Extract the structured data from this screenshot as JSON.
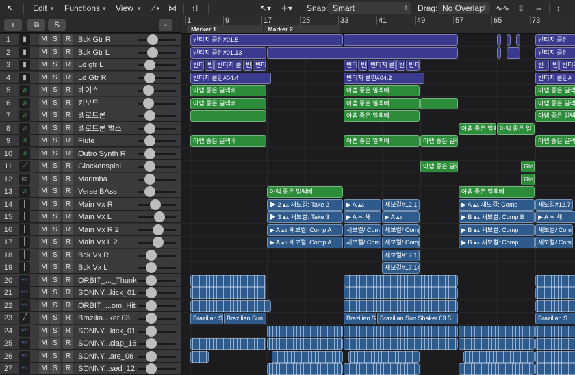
{
  "toolbar": {
    "edit": "Edit",
    "functions": "Functions",
    "view": "View",
    "snap_label": "Snap:",
    "snap_value": "Smart",
    "drag_label": "Drag:",
    "drag_value": "No Overlap"
  },
  "track_header": {
    "add": "+",
    "dup": "⧉",
    "s": "S"
  },
  "ruler": {
    "bars": [
      "1",
      "9",
      "17",
      "25",
      "33",
      "41",
      "49",
      "57",
      "65",
      "73"
    ],
    "markers": [
      "Marker 1",
      "Marker 2"
    ]
  },
  "msr": {
    "m": "M",
    "s": "S",
    "r": "R"
  },
  "tracks": [
    {
      "num": "1",
      "name": "Bck Gtr R",
      "icon": "amp"
    },
    {
      "num": "2",
      "name": "Bck Gtr L",
      "icon": "amp"
    },
    {
      "num": "3",
      "name": "Ld gtr L",
      "icon": "amp"
    },
    {
      "num": "4",
      "name": "Ld Gtr R",
      "icon": "amp"
    },
    {
      "num": "5",
      "name": "베이스",
      "icon": "note"
    },
    {
      "num": "6",
      "name": "키보드",
      "icon": "note"
    },
    {
      "num": "7",
      "name": "멜로트론",
      "icon": "note"
    },
    {
      "num": "8",
      "name": "멜로트론 벌스",
      "icon": "note"
    },
    {
      "num": "9",
      "name": "Flute",
      "icon": "note"
    },
    {
      "num": "10",
      "name": "Outro Synth R",
      "icon": "note"
    },
    {
      "num": "11",
      "name": "Glockenspiel",
      "icon": "mallet"
    },
    {
      "num": "12",
      "name": "Marimba",
      "icon": "marimba"
    },
    {
      "num": "13",
      "name": "Verse BAss",
      "icon": "note"
    },
    {
      "num": "14",
      "name": "Main Vx R",
      "icon": "mic"
    },
    {
      "num": "15",
      "name": "Main Vx L",
      "icon": "mic"
    },
    {
      "num": "16",
      "name": "Main Vx R 2",
      "icon": "mic"
    },
    {
      "num": "17",
      "name": "Main Vx L 2",
      "icon": "mic"
    },
    {
      "num": "18",
      "name": "Bck Vx R",
      "icon": "mic"
    },
    {
      "num": "19",
      "name": "Bck Vx L",
      "icon": "mic"
    },
    {
      "num": "20",
      "name": "ORBIT_..._Thunk",
      "icon": "wave"
    },
    {
      "num": "21",
      "name": "SONNY...kick_01",
      "icon": "wave"
    },
    {
      "num": "22",
      "name": "ORBIT_...om_Hit",
      "icon": "wave"
    },
    {
      "num": "23",
      "name": "Brazilia...ker 03",
      "icon": "stick"
    },
    {
      "num": "24",
      "name": "SONNY...kick_01",
      "icon": "wave"
    },
    {
      "num": "25",
      "name": "SONNY...clap_16",
      "icon": "wave"
    },
    {
      "num": "26",
      "name": "SONNY...are_06",
      "icon": "wave"
    },
    {
      "num": "27",
      "name": "SONNY...sed_12",
      "icon": "wave"
    }
  ],
  "volume_levels": [
    0.35,
    0.35,
    0.25,
    0.25,
    0.2,
    0.2,
    0.25,
    0.25,
    0.25,
    0.25,
    0.25,
    0.25,
    0.25,
    0.45,
    0.6,
    0.55,
    0.55,
    0.3,
    0.3,
    0.3,
    0.3,
    0.3,
    0.3,
    0.3,
    0.3,
    0.3,
    0.3
  ],
  "regions": [
    {
      "t": 1,
      "b": 1,
      "e": 33,
      "l": "빈티지 클린#01.5",
      "c": "blue"
    },
    {
      "t": 1,
      "b": 33,
      "e": 57,
      "l": "",
      "c": "blue"
    },
    {
      "t": 1,
      "b": 65,
      "e": 66,
      "l": "",
      "c": "blue"
    },
    {
      "t": 1,
      "b": 67,
      "e": 68,
      "l": "",
      "c": "blue"
    },
    {
      "t": 1,
      "b": 69,
      "e": 70,
      "l": "",
      "c": "blue"
    },
    {
      "t": 1,
      "b": 73,
      "e": 84,
      "l": "빈티지 클린",
      "c": "blue"
    },
    {
      "t": 2,
      "b": 1,
      "e": 17,
      "l": "빈티지 클린#01.13",
      "c": "blue"
    },
    {
      "t": 2,
      "b": 17,
      "e": 57,
      "l": "",
      "c": "blue"
    },
    {
      "t": 2,
      "b": 65,
      "e": 66,
      "l": "",
      "c": "blue"
    },
    {
      "t": 2,
      "b": 67,
      "e": 70,
      "l": "",
      "c": "blue"
    },
    {
      "t": 2,
      "b": 73,
      "e": 84,
      "l": "빈티지 클린",
      "c": "blue"
    },
    {
      "t": 3,
      "b": 1,
      "e": 4,
      "l": "빈티",
      "c": "blue"
    },
    {
      "t": 3,
      "b": 4,
      "e": 6,
      "l": "빈",
      "c": "blue"
    },
    {
      "t": 3,
      "b": 6,
      "e": 12,
      "l": "빈티지 클",
      "c": "blue"
    },
    {
      "t": 3,
      "b": 12,
      "e": 14,
      "l": "빈",
      "c": "blue"
    },
    {
      "t": 3,
      "b": 14,
      "e": 17,
      "l": "빈티",
      "c": "blue"
    },
    {
      "t": 3,
      "b": 33,
      "e": 36,
      "l": "빈티",
      "c": "blue"
    },
    {
      "t": 3,
      "b": 36,
      "e": 38,
      "l": "빈",
      "c": "blue"
    },
    {
      "t": 3,
      "b": 38,
      "e": 44,
      "l": "빈티지 클린",
      "c": "blue"
    },
    {
      "t": 3,
      "b": 44,
      "e": 46,
      "l": "빈",
      "c": "blue"
    },
    {
      "t": 3,
      "b": 46,
      "e": 49,
      "l": "빈티",
      "c": "blue"
    },
    {
      "t": 3,
      "b": 73,
      "e": 76,
      "l": "빈",
      "c": "blue"
    },
    {
      "t": 3,
      "b": 76,
      "e": 78,
      "l": "빈",
      "c": "blue"
    },
    {
      "t": 3,
      "b": 78,
      "e": 84,
      "l": "빈티지",
      "c": "blue"
    },
    {
      "t": 4,
      "b": 1,
      "e": 18,
      "l": "빈티지 클린#04.4",
      "c": "blue"
    },
    {
      "t": 4,
      "b": 33,
      "e": 50,
      "l": "빈티지 클린#04.2",
      "c": "blue"
    },
    {
      "t": 4,
      "b": 73,
      "e": 84,
      "l": "빈티지 클린#",
      "c": "blue"
    },
    {
      "t": 5,
      "b": 1,
      "e": 17,
      "l": "아랩 좋은 일렉베",
      "c": "green"
    },
    {
      "t": 5,
      "b": 33,
      "e": 49,
      "l": "아랩 좋은 일렉베",
      "c": "green"
    },
    {
      "t": 5,
      "b": 73,
      "e": 84,
      "l": "아랩 좋은 일렉",
      "c": "green"
    },
    {
      "t": 6,
      "b": 1,
      "e": 17,
      "l": "아랩 좋은 일렉베",
      "c": "green"
    },
    {
      "t": 6,
      "b": 33,
      "e": 49,
      "l": "아랩 좋은 일렉베",
      "c": "green"
    },
    {
      "t": 6,
      "b": 49,
      "e": 57,
      "l": "",
      "c": "green"
    },
    {
      "t": 6,
      "b": 73,
      "e": 84,
      "l": "아랩 좋은 일렉",
      "c": "green"
    },
    {
      "t": 7,
      "b": 1,
      "e": 17,
      "l": "",
      "c": "green"
    },
    {
      "t": 7,
      "b": 33,
      "e": 49,
      "l": "아랩 좋은 일렉베",
      "c": "green"
    },
    {
      "t": 7,
      "b": 73,
      "e": 84,
      "l": "아랩 좋은 일렉",
      "c": "green"
    },
    {
      "t": 8,
      "b": 57,
      "e": 65,
      "l": "아랩 좋은 일렉",
      "c": "green"
    },
    {
      "t": 8,
      "b": 65,
      "e": 73,
      "l": "아랩 좋은 일",
      "c": "green"
    },
    {
      "t": 9,
      "b": 1,
      "e": 17,
      "l": "아랩 좋은 일렉베",
      "c": "green"
    },
    {
      "t": 9,
      "b": 33,
      "e": 49,
      "l": "아랩 좋은 일렉베",
      "c": "green"
    },
    {
      "t": 9,
      "b": 49,
      "e": 57,
      "l": "아랩 좋은 일렉",
      "c": "green"
    },
    {
      "t": 9,
      "b": 73,
      "e": 84,
      "l": "아랩 좋은 일렉",
      "c": "green"
    },
    {
      "t": 11,
      "b": 49,
      "e": 57,
      "l": "아랩 좋은 일렉",
      "c": "green"
    },
    {
      "t": 11,
      "b": 70,
      "e": 73,
      "l": "Glo",
      "c": "green"
    },
    {
      "t": 12,
      "b": 70,
      "e": 73,
      "l": "Glo",
      "c": "green"
    },
    {
      "t": 13,
      "b": 17,
      "e": 33,
      "l": "아랩 좋은 일렉베",
      "c": "green"
    },
    {
      "t": 13,
      "b": 57,
      "e": 73,
      "l": "아랩 좋은 일렉베",
      "c": "green"
    },
    {
      "t": 14,
      "b": 17,
      "e": 33,
      "l": "▶ 2 ▴▵ 새보컬: Take 2",
      "c": "audio"
    },
    {
      "t": 14,
      "b": 33,
      "e": 41,
      "l": "▶ A ▴▵",
      "c": "audio"
    },
    {
      "t": 14,
      "b": 41,
      "e": 49,
      "l": "새보컬#12.1",
      "c": "audio"
    },
    {
      "t": 14,
      "b": 57,
      "e": 73,
      "l": "▶ A ▴▵ 새보컬: Comp",
      "c": "audio"
    },
    {
      "t": 14,
      "b": 73,
      "e": 81,
      "l": "새보컬#12.7",
      "c": "audio"
    },
    {
      "t": 15,
      "b": 17,
      "e": 33,
      "l": "▶ 3 ▴▵ 새보컬: Take 3",
      "c": "audio"
    },
    {
      "t": 15,
      "b": 33,
      "e": 41,
      "l": "▶ A ✂ 새",
      "c": "audio"
    },
    {
      "t": 15,
      "b": 41,
      "e": 49,
      "l": "▶ A ▴▵",
      "c": "audio"
    },
    {
      "t": 15,
      "b": 57,
      "e": 73,
      "l": "▶ B ▴▵ 새보컬: Comp B",
      "c": "audio"
    },
    {
      "t": 15,
      "b": 73,
      "e": 84,
      "l": "▶ A ✂ 새",
      "c": "audio"
    },
    {
      "t": 16,
      "b": 17,
      "e": 33,
      "l": "▶ A ▴▵ 새보컬: Comp A",
      "c": "audio"
    },
    {
      "t": 16,
      "b": 33,
      "e": 41,
      "l": "새보컬/ Com",
      "c": "audio"
    },
    {
      "t": 16,
      "b": 41,
      "e": 49,
      "l": "새보컬/ Comp",
      "c": "audio"
    },
    {
      "t": 16,
      "b": 57,
      "e": 73,
      "l": "▶ B ▴▵ 새보컬: Comp",
      "c": "audio"
    },
    {
      "t": 16,
      "b": 73,
      "e": 81,
      "l": "새보컬/ Com",
      "c": "audio"
    },
    {
      "t": 17,
      "b": 17,
      "e": 33,
      "l": "▶ A ▴▵ 새보컬: Comp A",
      "c": "audio"
    },
    {
      "t": 17,
      "b": 33,
      "e": 41,
      "l": "새보컬/ Com",
      "c": "audio"
    },
    {
      "t": 17,
      "b": 41,
      "e": 49,
      "l": "새보컬/ Comp",
      "c": "audio"
    },
    {
      "t": 17,
      "b": 57,
      "e": 73,
      "l": "▶ B ▴▵ 새보컬: Comp",
      "c": "audio"
    },
    {
      "t": 17,
      "b": 73,
      "e": 81,
      "l": "새보컬/ Com",
      "c": "audio"
    },
    {
      "t": 18,
      "b": 41,
      "e": 49,
      "l": "새보컬#17.13",
      "c": "audio"
    },
    {
      "t": 19,
      "b": 41,
      "e": 49,
      "l": "새보컬#17.14",
      "c": "audio"
    },
    {
      "t": 20,
      "b": 1,
      "e": 17,
      "l": "",
      "c": "stripe"
    },
    {
      "t": 20,
      "b": 33,
      "e": 57,
      "l": "",
      "c": "stripe"
    },
    {
      "t": 20,
      "b": 73,
      "e": 84,
      "l": "",
      "c": "stripe"
    },
    {
      "t": 21,
      "b": 1,
      "e": 17,
      "l": "",
      "c": "stripe"
    },
    {
      "t": 21,
      "b": 33,
      "e": 57,
      "l": "",
      "c": "stripe"
    },
    {
      "t": 21,
      "b": 73,
      "e": 84,
      "l": "",
      "c": "stripe"
    },
    {
      "t": 22,
      "b": 1,
      "e": 18,
      "l": "",
      "c": "stripe"
    },
    {
      "t": 22,
      "b": 33,
      "e": 57,
      "l": "",
      "c": "stripe"
    },
    {
      "t": 22,
      "b": 73,
      "e": 84,
      "l": "",
      "c": "stripe"
    },
    {
      "t": 23,
      "b": 1,
      "e": 8,
      "l": "Brazilian S",
      "c": "audio"
    },
    {
      "t": 23,
      "b": 8,
      "e": 17,
      "l": "Brazilian Sun",
      "c": "audio"
    },
    {
      "t": 23,
      "b": 33,
      "e": 40,
      "l": "Brazilian S",
      "c": "audio"
    },
    {
      "t": 23,
      "b": 40,
      "e": 57,
      "l": "Brazilian Sun Shaker 03.5",
      "c": "audio"
    },
    {
      "t": 23,
      "b": 73,
      "e": 84,
      "l": "Brazilian S",
      "c": "audio"
    },
    {
      "t": 24,
      "b": 17,
      "e": 33,
      "l": "",
      "c": "stripe"
    },
    {
      "t": 24,
      "b": 33,
      "e": 57,
      "l": "",
      "c": "stripe"
    },
    {
      "t": 24,
      "b": 57,
      "e": 73,
      "l": "",
      "c": "stripe"
    },
    {
      "t": 24,
      "b": 73,
      "e": 84,
      "l": "",
      "c": "stripe"
    },
    {
      "t": 25,
      "b": 1,
      "e": 17,
      "l": "",
      "c": "stripe"
    },
    {
      "t": 25,
      "b": 17,
      "e": 33,
      "l": "",
      "c": "stripe"
    },
    {
      "t": 25,
      "b": 33,
      "e": 57,
      "l": "",
      "c": "stripe"
    },
    {
      "t": 25,
      "b": 57,
      "e": 73,
      "l": "",
      "c": "stripe"
    },
    {
      "t": 25,
      "b": 73,
      "e": 84,
      "l": "",
      "c": "stripe"
    },
    {
      "t": 26,
      "b": 1,
      "e": 5,
      "l": "",
      "c": "stripe"
    },
    {
      "t": 26,
      "b": 18,
      "e": 33,
      "l": "",
      "c": "stripe"
    },
    {
      "t": 26,
      "b": 34,
      "e": 49,
      "l": "",
      "c": "stripe"
    },
    {
      "t": 26,
      "b": 58,
      "e": 73,
      "l": "",
      "c": "stripe"
    },
    {
      "t": 26,
      "b": 73,
      "e": 84,
      "l": "",
      "c": "stripe"
    },
    {
      "t": 27,
      "b": 17,
      "e": 33,
      "l": "",
      "c": "stripe"
    },
    {
      "t": 27,
      "b": 33,
      "e": 49,
      "l": "",
      "c": "stripe"
    },
    {
      "t": 27,
      "b": 57,
      "e": 73,
      "l": "",
      "c": "stripe"
    },
    {
      "t": 27,
      "b": 73,
      "e": 84,
      "l": "",
      "c": "stripe"
    }
  ]
}
